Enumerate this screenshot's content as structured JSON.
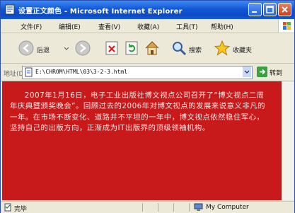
{
  "window": {
    "title": "设置正文颜色 - Microsoft Internet Explorer"
  },
  "menu": {
    "items": [
      "文件(F)",
      "编辑(E)",
      "查看(V)",
      "收藏(A)",
      "工具(T)",
      "帮助(H)"
    ]
  },
  "toolbar": {
    "back_label": "后退",
    "search_label": "搜索",
    "favorites_label": "收藏夹"
  },
  "address": {
    "label": "地址(D)",
    "url": "E:\\CHROM\\HTML\\03\\3-2-3.html",
    "go_label": "转到"
  },
  "content": {
    "background_color": "#c8191b",
    "text_color": "#f7e6e6",
    "paragraph": "2007年1月16日，电子工业出版社博文视点公司召开了“博文视点二周年庆典暨颁奖晚会”。回顾过去的2006年对博文视点的发展来说意义非凡的一年。在市场不断变化、道路并不平坦的一年中，博文视点依然稳住军心，坚持自己的出版方向，正渐成为IT出版界的顶级领袖机构。"
  },
  "status": {
    "left_text": "完毕",
    "zone_text": "My Computer"
  }
}
